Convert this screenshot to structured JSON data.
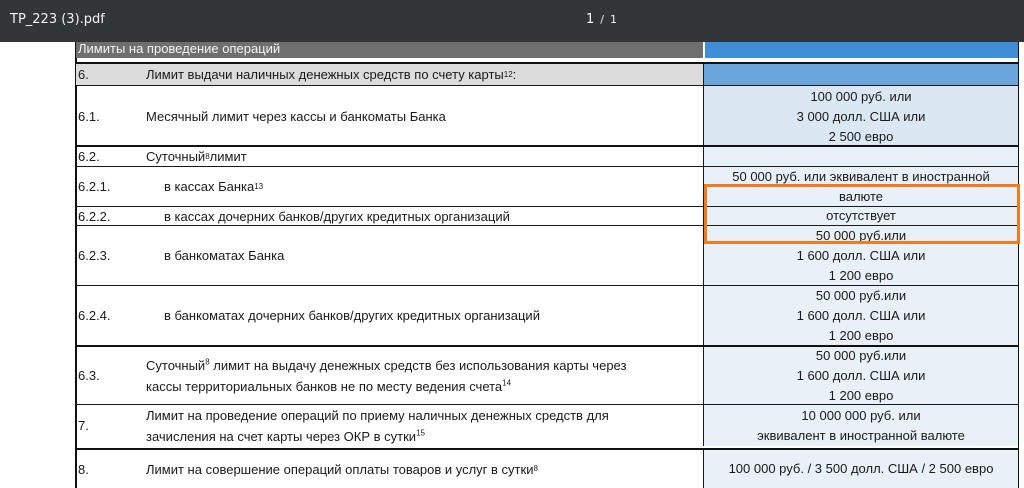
{
  "viewer": {
    "title": "TP_223 (3).pdf",
    "page_current": "1",
    "page_sep": "/",
    "page_total": "1"
  },
  "section": {
    "heading": "Лимиты на проведение операций"
  },
  "rows": [
    {
      "num": "6.",
      "desc": "Лимит выдачи наличных денежных средств по счету карты",
      "sup": "12",
      "tail": ":",
      "val": []
    },
    {
      "num": "6.1.",
      "desc": "Месячный лимит через кассы и банкоматы Банка",
      "val": [
        "100 000 руб. или",
        "3 000 долл. США или",
        "2 500 евро"
      ]
    },
    {
      "num": "6.2.",
      "desc": "Суточный",
      "sup": "8",
      "tail": " лимит",
      "val": []
    },
    {
      "num": "6.2.1.",
      "desc": "в кассах Банка",
      "sup": "13",
      "val": [
        "50 000 руб. или эквивалент в иностранной",
        "валюте"
      ]
    },
    {
      "num": "6.2.2.",
      "desc": "в кассах дочерних банков/других кредитных организаций",
      "val": [
        "отсутствует"
      ]
    },
    {
      "num": "6.2.3.",
      "desc": "в банкоматах Банка",
      "val": [
        "50 000 руб.или",
        "1 600 долл. США или",
        "1 200 евро"
      ]
    },
    {
      "num": "6.2.4.",
      "desc": "в банкоматах дочерних банков/других кредитных организаций",
      "val": [
        "50 000 руб.или",
        "1 600 долл. США или",
        "1 200 евро"
      ]
    },
    {
      "num": "6.3.",
      "desc": "Суточный",
      "sup": "8",
      "tail": " лимит на выдачу денежных средств без использования карты через",
      "desc2": "кассы территориальных банков не по месту ведения счета",
      "sup2": "14",
      "val": [
        "50 000 руб.или",
        "1 600 долл. США или",
        "1 200 евро"
      ]
    },
    {
      "num": "7.",
      "desc": "Лимит на проведение операций по приему наличных денежных средств для",
      "desc2": "зачисления на счет карты через ОКР в сутки",
      "sup2": "15",
      "val": [
        "10 000 000 руб. или",
        "эквивалент в иностранной валюте"
      ]
    },
    {
      "num": "8.",
      "desc": "Лимит на совершение операций оплаты товаров и услуг в сутки",
      "sup": "8",
      "val": [
        "100 000 руб. / 3 500 долл. США / 2 500 евро"
      ]
    }
  ]
}
